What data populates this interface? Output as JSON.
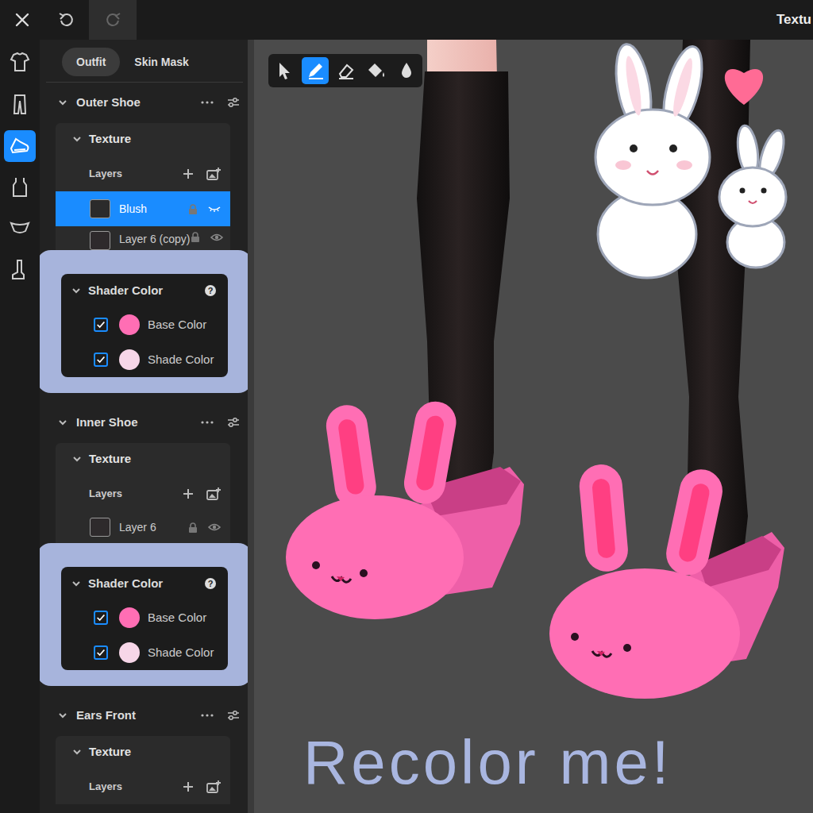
{
  "window": {
    "title": "Textu"
  },
  "rail": [
    {
      "selected": false
    },
    {
      "selected": false
    },
    {
      "selected": true
    },
    {
      "selected": false
    },
    {
      "selected": false
    },
    {
      "selected": false
    }
  ],
  "tabs": [
    {
      "label": "Outfit",
      "selected": true
    },
    {
      "label": "Skin Mask",
      "selected": false
    }
  ],
  "tools": [
    {
      "selected": false
    },
    {
      "selected": true
    },
    {
      "selected": false
    },
    {
      "selected": false
    },
    {
      "selected": false
    }
  ],
  "sections": [
    {
      "title": "Outer Shoe",
      "texture": {
        "title": "Texture",
        "layers_label": "Layers",
        "layers": [
          {
            "name": "Blush",
            "selected": true,
            "visible": false,
            "color": "#2b2b2b"
          },
          {
            "name": "Layer 6 (copy)",
            "selected": false,
            "visible": true,
            "color": "#2e2a2c"
          }
        ]
      },
      "shader": {
        "title": "Shader Color",
        "colors": [
          {
            "label": "Base Color",
            "checked": true,
            "color": "#ff6eb4"
          },
          {
            "label": "Shade Color",
            "checked": true,
            "color": "#f7d6e8"
          }
        ]
      }
    },
    {
      "title": "Inner Shoe",
      "texture": {
        "title": "Texture",
        "layers_label": "Layers",
        "layers": [
          {
            "name": "Layer 6",
            "selected": false,
            "visible": true,
            "color": "#2e2a2c"
          }
        ]
      },
      "shader": {
        "title": "Shader Color",
        "colors": [
          {
            "label": "Base Color",
            "checked": true,
            "color": "#ff6eb4"
          },
          {
            "label": "Shade Color",
            "checked": true,
            "color": "#f7d6e8"
          }
        ]
      }
    },
    {
      "title": "Ears Front",
      "texture": {
        "title": "Texture",
        "layers_label": "Layers",
        "layers": []
      }
    }
  ],
  "annotation": {
    "text": "Recolor me!"
  }
}
